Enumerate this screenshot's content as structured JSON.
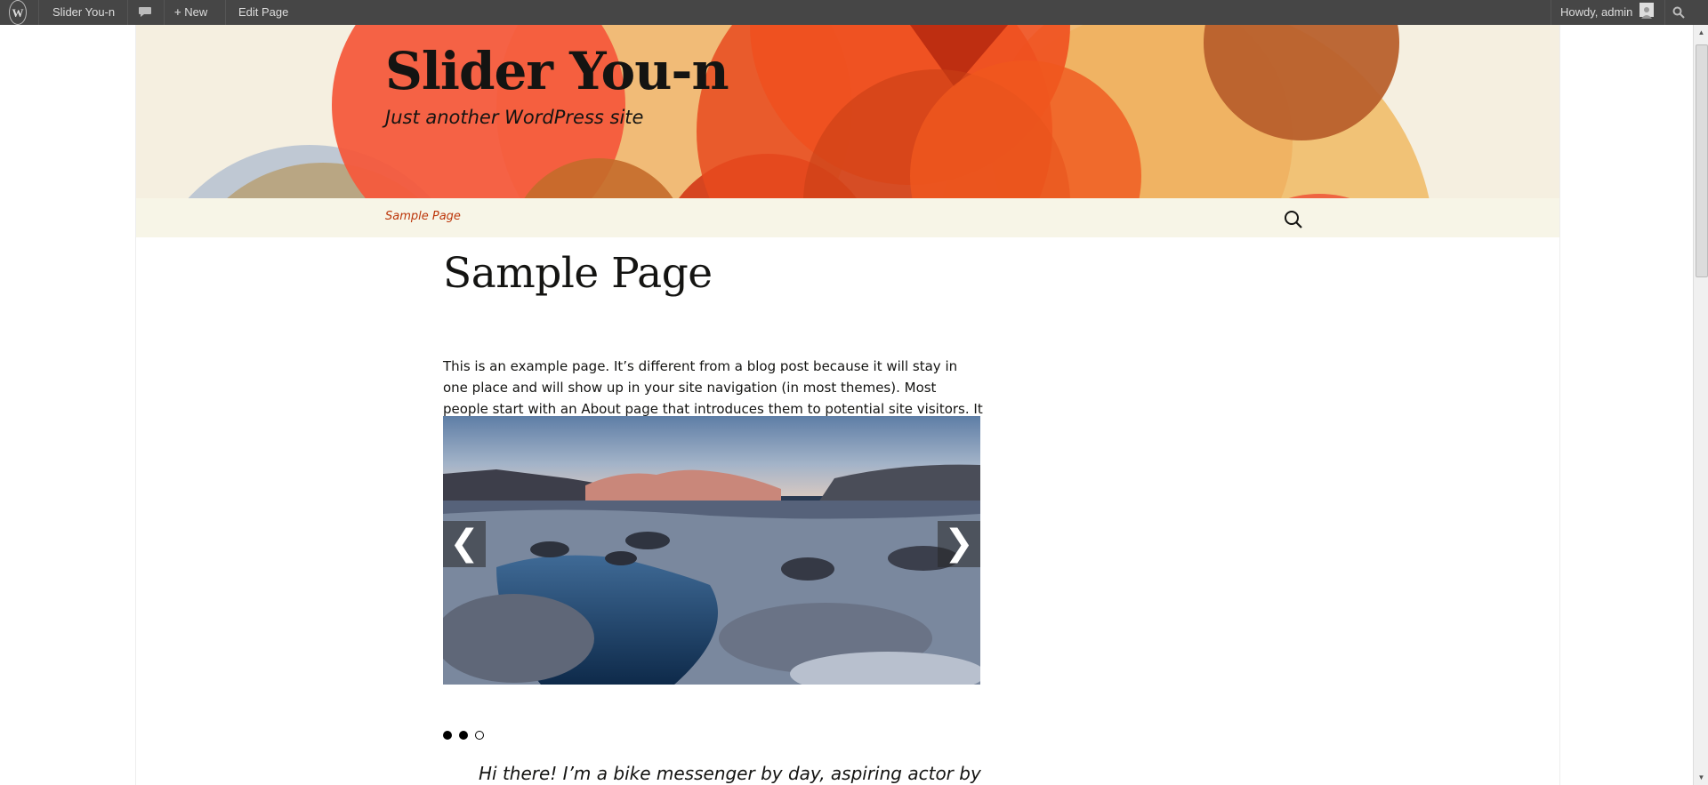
{
  "admin_bar": {
    "logo_icon": "wordpress-icon",
    "site_name": "Slider You-n",
    "comments_icon": "comment-bubble-icon",
    "new_label": "New",
    "new_icon": "plus-icon",
    "edit_label": "Edit Page",
    "howdy": "Howdy, admin",
    "avatar_icon": "avatar-icon",
    "search_icon": "search-icon"
  },
  "header": {
    "site_title": "Slider You-n",
    "site_description": "Just another WordPress site"
  },
  "nav": {
    "items": [
      {
        "label": "Sample Page"
      }
    ],
    "search_icon": "search-icon"
  },
  "content": {
    "title": "Sample Page",
    "paragraph": "This is an example page. It’s different from a blog post because it will stay in one place and will show up in your site navigation (in most themes). Most people start with an About page that introduces them to potential site visitors. It might say something like this:",
    "slider": {
      "prev_label": "❮",
      "next_label": "❯",
      "dots": [
        {
          "active": true
        },
        {
          "active": true
        },
        {
          "active": false
        }
      ]
    },
    "quote_start": "Hi there! I’m a bike messenger by day, aspiring actor by"
  },
  "colors": {
    "admin_bar": "#464646",
    "header_bg": "#f5efe0",
    "nav_bg": "#f7f5e7",
    "link": "#bc360a",
    "text": "#141412"
  }
}
